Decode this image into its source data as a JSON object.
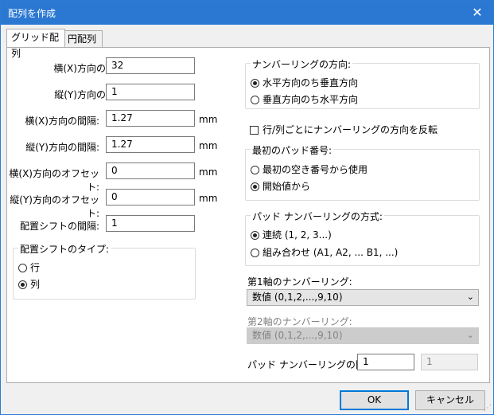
{
  "window": {
    "title": "配列を作成",
    "close_glyph": "✕"
  },
  "tabs": [
    {
      "label": "グリッド配列"
    },
    {
      "label": "円配列"
    }
  ],
  "grid": {
    "count_x": {
      "label": "横(X)方向の数:",
      "value": "32"
    },
    "count_y": {
      "label": "縦(Y)方向の数:",
      "value": "1"
    },
    "spacing_x": {
      "label": "横(X)方向の間隔:",
      "value": "1.27",
      "unit": "mm"
    },
    "spacing_y": {
      "label": "縦(Y)方向の間隔:",
      "value": "1.27",
      "unit": "mm"
    },
    "offset_x": {
      "label": "横(X)方向のオフセット:",
      "value": "0",
      "unit": "mm"
    },
    "offset_y": {
      "label": "縦(Y)方向のオフセット:",
      "value": "0",
      "unit": "mm"
    },
    "stagger": {
      "label": "配置シフトの間隔:",
      "value": "1"
    },
    "stagger_type": {
      "title": "配置シフトのタイプ:",
      "options": [
        {
          "label": "行",
          "selected": false
        },
        {
          "label": "列",
          "selected": true
        }
      ]
    }
  },
  "numbering_direction": {
    "title": "ナンバーリングの方向:",
    "options": [
      {
        "label": "水平方向のち垂直方向",
        "selected": true
      },
      {
        "label": "垂直方向のち水平方向",
        "selected": false
      }
    ]
  },
  "reverse_checkbox": {
    "label": "行/列ごとにナンバーリングの方向を反転",
    "checked": false
  },
  "first_pad": {
    "title": "最初のパッド番号:",
    "options": [
      {
        "label": "最初の空き番号から使用",
        "selected": false
      },
      {
        "label": "開始値から",
        "selected": true
      }
    ]
  },
  "numbering_scheme": {
    "title": "パッド ナンバーリングの方式:",
    "options": [
      {
        "label": "連続 (1, 2, 3...)",
        "selected": true
      },
      {
        "label": "組み合わせ (A1, A2, ... B1, ...)",
        "selected": false
      }
    ]
  },
  "axis1": {
    "label": "第1軸のナンバーリング:",
    "value": "数値 (0,1,2,...,9,10)"
  },
  "axis2": {
    "label": "第2軸のナンバーリング:",
    "value": "数値 (0,1,2,...,9,10)"
  },
  "start": {
    "label": "パッド ナンバーリングの開始:",
    "value1": "1",
    "value2": "1"
  },
  "buttons": {
    "ok": "OK",
    "cancel": "キャンセル"
  },
  "icons": {
    "dropdown": "chevron-down-icon",
    "close": "close-icon"
  }
}
